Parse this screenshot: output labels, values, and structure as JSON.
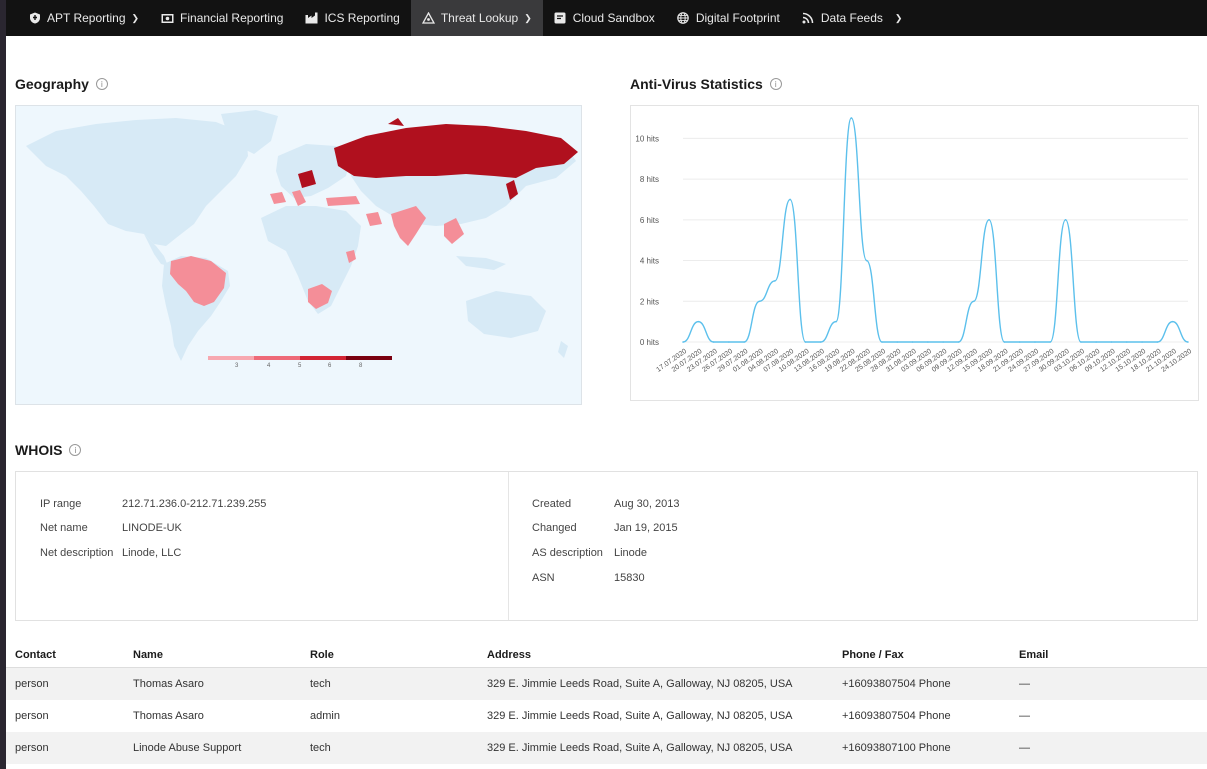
{
  "nav": {
    "items": [
      {
        "label": "APT Reporting",
        "icon": "shield-icon",
        "chevron": true,
        "active": false
      },
      {
        "label": "Financial Reporting",
        "icon": "banknote-icon",
        "chevron": false,
        "active": false
      },
      {
        "label": "ICS Reporting",
        "icon": "factory-icon",
        "chevron": false,
        "active": false
      },
      {
        "label": "Threat Lookup",
        "icon": "biohazard-icon",
        "chevron": true,
        "active": true
      },
      {
        "label": "Cloud Sandbox",
        "icon": "sandbox-icon",
        "chevron": false,
        "active": false
      },
      {
        "label": "Digital Footprint",
        "icon": "globe-icon",
        "chevron": false,
        "active": false
      },
      {
        "label": "Data Feeds",
        "icon": "rss-icon",
        "chevron": true,
        "active": false
      }
    ]
  },
  "geography": {
    "title": "Geography",
    "legend_ticks": [
      "3",
      "4",
      "5",
      "6",
      "8"
    ],
    "colors": {
      "ocean": "#eef7fd",
      "land": "#d7eaf6",
      "low": "#f48e98",
      "high": "#b0101e"
    }
  },
  "antivirus": {
    "title": "Anti-Virus Statistics"
  },
  "chart_data": {
    "type": "line",
    "title": "Anti-Virus Statistics",
    "ylabel": "",
    "xlabel": "",
    "ylim": [
      0,
      11
    ],
    "y_ticks": [
      "0 hits",
      "2 hits",
      "4 hits",
      "6 hits",
      "8 hits",
      "10 hits"
    ],
    "x": [
      "17.07.2020",
      "20.07.2020",
      "23.07.2020",
      "26.07.2020",
      "29.07.2020",
      "01.08.2020",
      "04.08.2020",
      "07.08.2020",
      "10.08.2020",
      "13.08.2020",
      "16.08.2020",
      "19.08.2020",
      "22.08.2020",
      "25.08.2020",
      "28.08.2020",
      "31.08.2020",
      "03.09.2020",
      "06.09.2020",
      "09.09.2020",
      "12.09.2020",
      "15.09.2020",
      "18.09.2020",
      "21.09.2020",
      "24.09.2020",
      "27.09.2020",
      "30.09.2020",
      "03.10.2020",
      "06.10.2020",
      "09.10.2020",
      "12.10.2020",
      "15.10.2020",
      "18.10.2020",
      "21.10.2020",
      "24.10.2020"
    ],
    "series": [
      {
        "values": [
          0,
          1,
          0,
          0,
          0,
          2,
          3,
          7,
          0,
          0,
          1,
          11,
          4,
          0,
          0,
          0,
          0,
          0,
          0,
          2,
          6,
          0,
          0,
          0,
          0,
          6,
          0,
          0,
          0,
          0,
          0,
          0,
          1,
          0
        ]
      }
    ],
    "color": "#5cc0ec",
    "grid": true
  },
  "whois": {
    "title": "WHOIS",
    "left": [
      {
        "key": "IP range",
        "value": "212.71.236.0-212.71.239.255"
      },
      {
        "key": "Net name",
        "value": "LINODE-UK"
      },
      {
        "key": "Net description",
        "value": "Linode, LLC"
      }
    ],
    "right": [
      {
        "key": "Created",
        "value": "Aug 30, 2013"
      },
      {
        "key": "Changed",
        "value": "Jan 19, 2015"
      },
      {
        "key": "AS description",
        "value": "Linode"
      },
      {
        "key": "ASN",
        "value": "15830"
      }
    ]
  },
  "contacts": {
    "headers": [
      "Contact",
      "Name",
      "Role",
      "Address",
      "Phone / Fax",
      "Email"
    ],
    "rows": [
      [
        "person",
        "Thomas Asaro",
        "tech",
        "329 E. Jimmie Leeds Road, Suite A, Galloway, NJ 08205, USA",
        "+16093807504 Phone",
        "—"
      ],
      [
        "person",
        "Thomas Asaro",
        "admin",
        "329 E. Jimmie Leeds Road, Suite A, Galloway, NJ 08205, USA",
        "+16093807504 Phone",
        "—"
      ],
      [
        "person",
        "Linode Abuse Support",
        "tech",
        "329 E. Jimmie Leeds Road, Suite A, Galloway, NJ 08205, USA",
        "+16093807100 Phone",
        "—"
      ]
    ]
  }
}
